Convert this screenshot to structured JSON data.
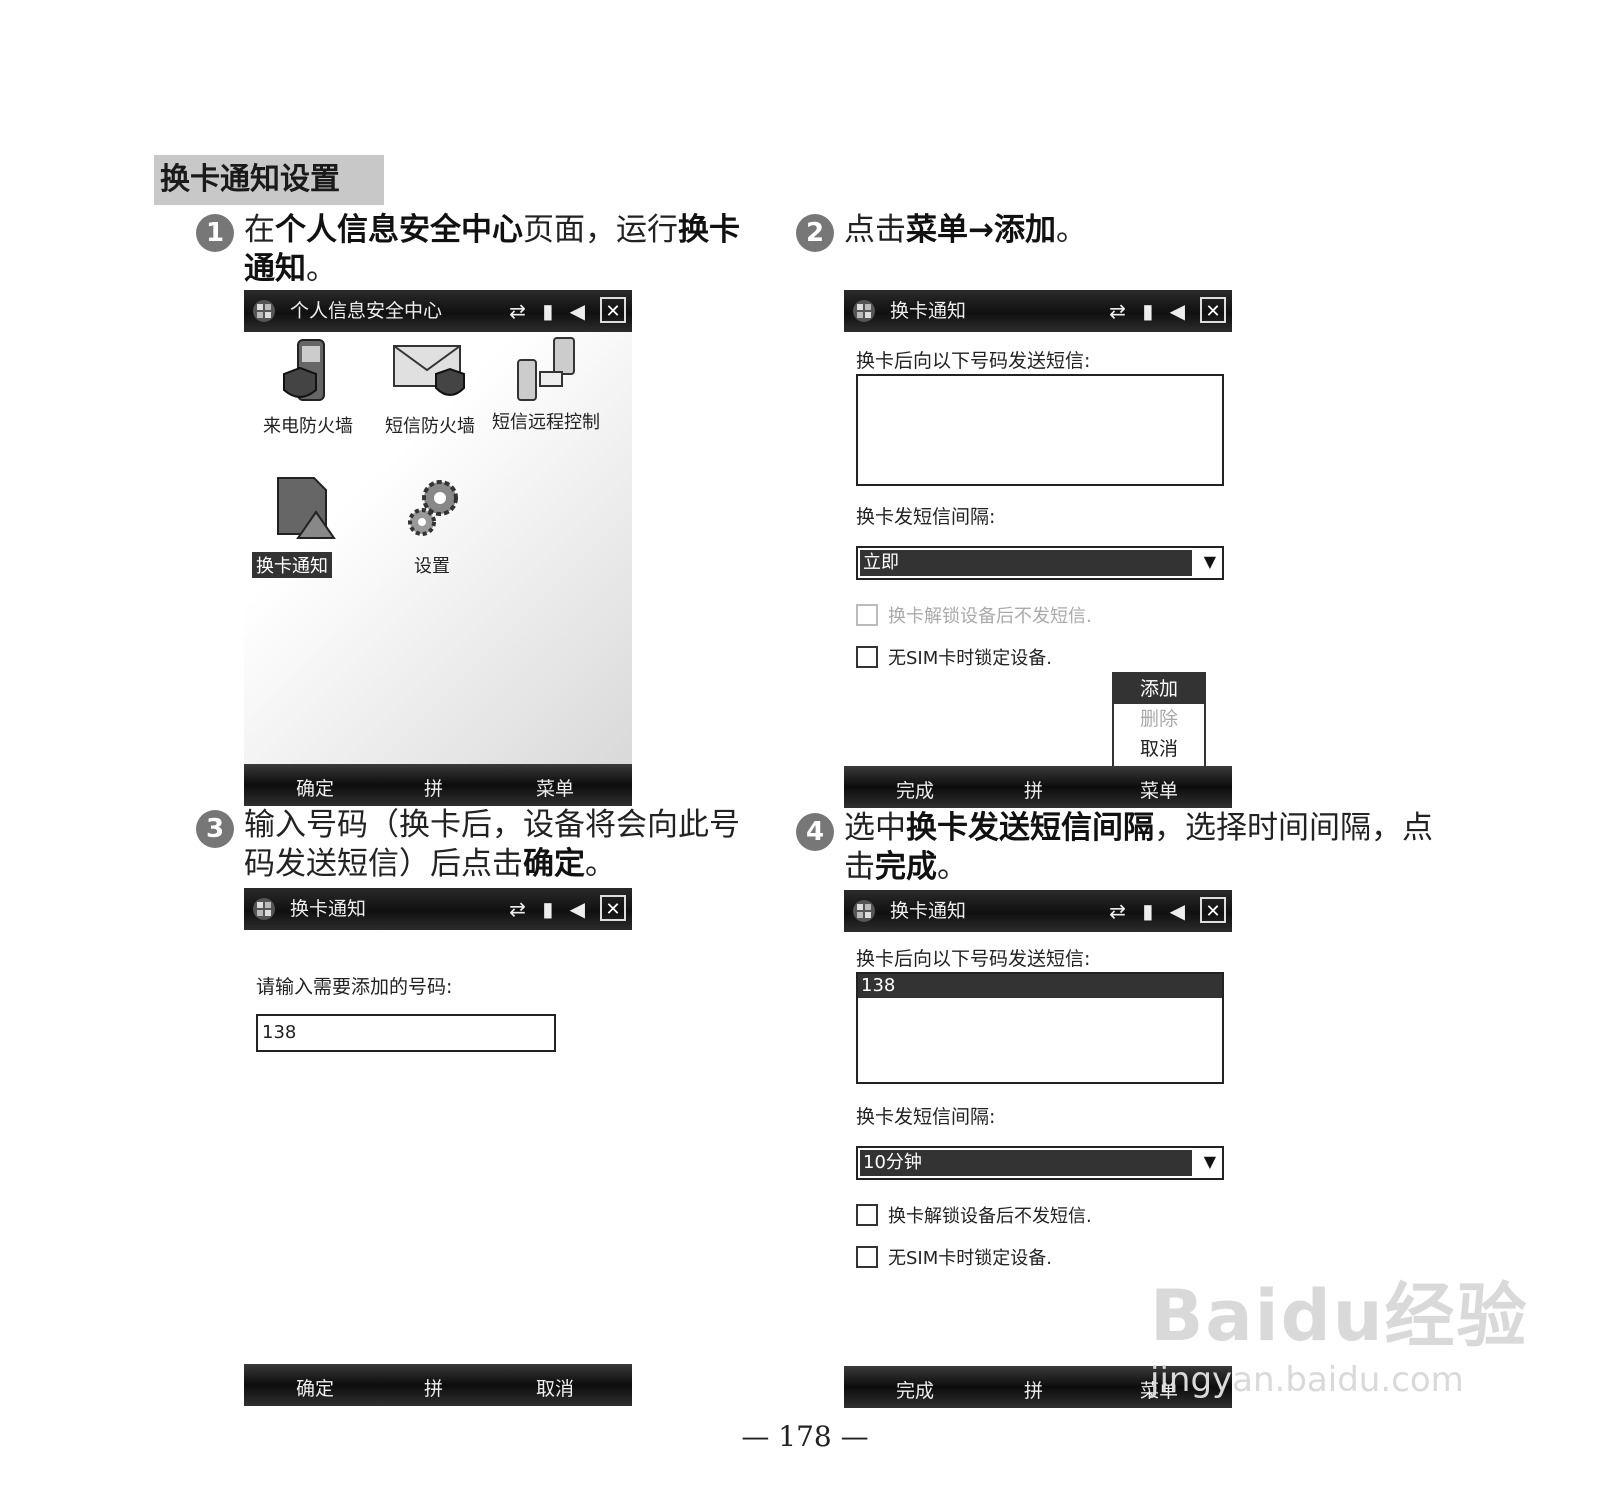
{
  "section_title": "换卡通知设置",
  "steps": [
    {
      "num": "1",
      "parts": [
        {
          "t": "在",
          "b": false
        },
        {
          "t": "个人信息安全中心",
          "b": true
        },
        {
          "t": "页面，运行",
          "b": false
        },
        {
          "t": "换卡通知",
          "b": true
        },
        {
          "t": "。",
          "b": false
        }
      ]
    },
    {
      "num": "2",
      "parts": [
        {
          "t": "点击",
          "b": false
        },
        {
          "t": "菜单",
          "b": true
        },
        {
          "t": "→",
          "b": true
        },
        {
          "t": "添加",
          "b": true
        },
        {
          "t": "。",
          "b": false
        }
      ]
    },
    {
      "num": "3",
      "parts": [
        {
          "t": "输入号码（换卡后，设备将会向此号码发送短信）后点击",
          "b": false
        },
        {
          "t": "确定",
          "b": true
        },
        {
          "t": "。",
          "b": false
        }
      ]
    },
    {
      "num": "4",
      "parts": [
        {
          "t": "选中",
          "b": false
        },
        {
          "t": "换卡发送短信间隔",
          "b": true
        },
        {
          "t": "，选择时间间隔，点击",
          "b": false
        },
        {
          "t": "完成",
          "b": true
        },
        {
          "t": "。",
          "b": false
        }
      ]
    }
  ],
  "screen1": {
    "title": "个人信息安全中心",
    "status": "⇄ ▮ ◀",
    "icons": [
      {
        "label": "来电防火墙",
        "icon": "phone-shield-icon"
      },
      {
        "label": "短信防火墙",
        "icon": "mail-shield-icon"
      },
      {
        "label": "短信远程控制",
        "icon": "remote-sms-icon"
      },
      {
        "label": "换卡通知",
        "icon": "simcard-warning-icon"
      },
      {
        "label": "设置",
        "icon": "gears-icon"
      }
    ],
    "soft": {
      "left": "确定",
      "mid": "拼",
      "right": "菜单"
    }
  },
  "screen2": {
    "title": "换卡通知",
    "label1": "换卡后向以下号码发送短信:",
    "label2": "换卡发短信间隔:",
    "dropdown": "立即",
    "chk1": "换卡解锁设备后不发短信.",
    "chk2": "无SIM卡时锁定设备.",
    "menu": [
      "添加",
      "删除",
      "取消"
    ],
    "soft": {
      "left": "完成",
      "mid": "拼",
      "right": "菜单"
    }
  },
  "screen3": {
    "title": "换卡通知",
    "prompt": "请输入需要添加的号码:",
    "input": "138",
    "soft": {
      "left": "确定",
      "mid": "拼",
      "right": "取消"
    }
  },
  "screen4": {
    "title": "换卡通知",
    "label1": "换卡后向以下号码发送短信:",
    "list_item": "138",
    "label2": "换卡发短信间隔:",
    "dropdown": "10分钟",
    "chk1": "换卡解锁设备后不发短信.",
    "chk2": "无SIM卡时锁定设备.",
    "soft": {
      "left": "完成",
      "mid": "拼",
      "right": "菜单"
    }
  },
  "page_number": "— 178 —",
  "watermark": {
    "brand": "Baidu经验",
    "url": "jingyan.baidu.com"
  }
}
